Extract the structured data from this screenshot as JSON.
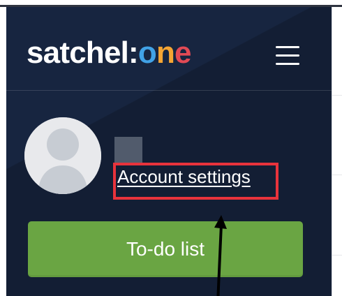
{
  "logo": {
    "prefix": "satchel:",
    "o": "o",
    "n": "n",
    "e": "e"
  },
  "profile": {
    "account_settings_label": "Account settings"
  },
  "buttons": {
    "todo_label": "To-do list"
  },
  "icons": {
    "menu": "hamburger-menu-icon",
    "avatar": "user-avatar-icon",
    "annotation": "arrow-up-icon"
  },
  "colors": {
    "sidebar": "#172540",
    "todo_button": "#6aa543",
    "highlight": "#e8333c",
    "logo_o": "#41a2e6",
    "logo_n": "#f5a533",
    "logo_e": "#e24a55"
  }
}
